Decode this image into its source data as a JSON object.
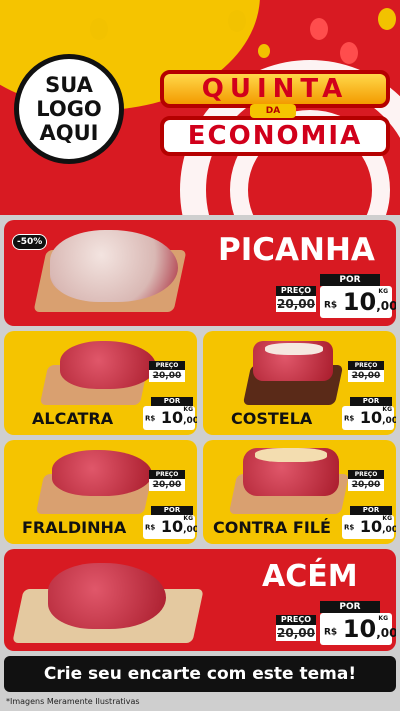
{
  "header": {
    "logo_lines": [
      "SUA",
      "LOGO",
      "AQUI"
    ],
    "title_top": "QUINTA",
    "title_mid": "DA",
    "title_bottom": "ECONOMIA"
  },
  "label_preco": "PREÇO",
  "label_por": "POR",
  "currency": "R$",
  "unit": "KG",
  "products": [
    {
      "name": "PICANHA",
      "badge": "-50%",
      "old_price": "20,00",
      "new_price_int": "10",
      "new_price_dec": ",00"
    },
    {
      "name": "ALCATRA",
      "old_price": "20,00",
      "new_price_int": "10",
      "new_price_dec": ",00"
    },
    {
      "name": "COSTELA",
      "old_price": "20,00",
      "new_price_int": "10",
      "new_price_dec": ",00"
    },
    {
      "name": "FRALDINHA",
      "old_price": "20,00",
      "new_price_int": "10",
      "new_price_dec": ",00"
    },
    {
      "name": "CONTRA FILÉ",
      "old_price": "20,00",
      "new_price_int": "10",
      "new_price_dec": ",00"
    },
    {
      "name": "ACÉM",
      "old_price": "20,00",
      "new_price_int": "10",
      "new_price_dec": ",00"
    }
  ],
  "footer": {
    "cta": "Crie seu encarte com este tema!",
    "disclaimer": "*Imagens Meramente Ilustrativas"
  },
  "colors": {
    "red": "#d81a22",
    "yellow": "#f5c400",
    "black": "#111111"
  }
}
